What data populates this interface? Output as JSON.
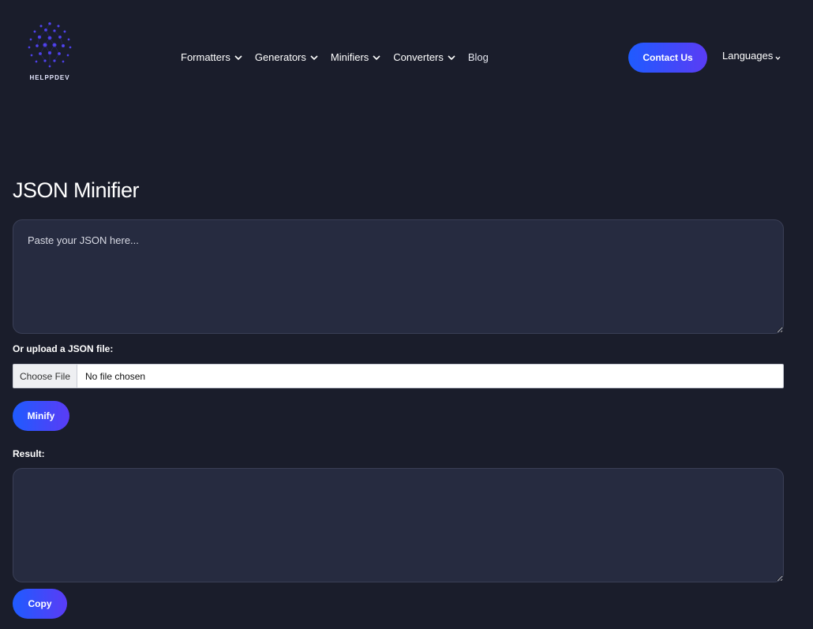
{
  "brand": {
    "name": "HELPPDEV"
  },
  "nav": {
    "items": [
      {
        "label": "Formatters",
        "dropdown": true
      },
      {
        "label": "Generators",
        "dropdown": true
      },
      {
        "label": "Minifiers",
        "dropdown": true
      },
      {
        "label": "Converters",
        "dropdown": true
      },
      {
        "label": "Blog",
        "dropdown": false
      }
    ],
    "contact_label": "Contact Us",
    "languages_label": "Languages"
  },
  "page": {
    "title": "JSON Minifier",
    "input_placeholder": "Paste your JSON here...",
    "input_value": "",
    "upload_label": "Or upload a JSON file:",
    "choose_file_label": "Choose File",
    "file_status": "No file chosen",
    "minify_label": "Minify",
    "result_label": "Result:",
    "result_value": "",
    "copy_label": "Copy"
  },
  "colors": {
    "background": "#1a1d2b",
    "panel": "#262b40",
    "accent_start": "#1f5bff",
    "accent_end": "#5a3cf5"
  }
}
